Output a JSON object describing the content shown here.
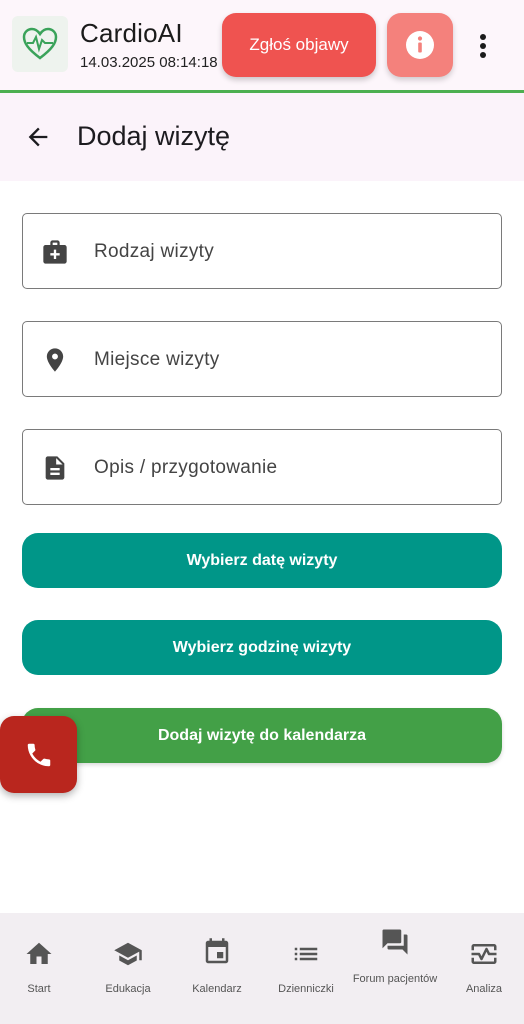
{
  "app": {
    "title": "CardioAI",
    "datetime": "14.03.2025 08:14:18",
    "logo_icon": "heart-ecg-icon",
    "report_button": "Zgłoś objawy",
    "info_icon": "info-icon",
    "menu_icon": "more-vert-icon"
  },
  "header": {
    "back_icon": "arrow-back-icon",
    "title": "Dodaj wizytę"
  },
  "form": {
    "visit_type": {
      "icon": "medical-bag-icon",
      "placeholder": "Rodzaj wizyty"
    },
    "visit_place": {
      "icon": "location-pin-icon",
      "placeholder": "Miejsce wizyty"
    },
    "visit_description": {
      "icon": "document-icon",
      "placeholder": "Opis / przygotowanie"
    },
    "choose_date": "Wybierz datę wizyty",
    "choose_time": "Wybierz godzinę wizyty",
    "add_to_calendar": "Dodaj wizytę do kalendarza"
  },
  "call_fab": {
    "icon": "phone-icon"
  },
  "bottom_nav": {
    "items": [
      {
        "label": "Start",
        "icon": "home-icon"
      },
      {
        "label": "Edukacja",
        "icon": "school-icon"
      },
      {
        "label": "Kalendarz",
        "icon": "calendar-icon"
      },
      {
        "label": "Dzienniczki",
        "icon": "list-icon"
      },
      {
        "label": "Forum pacjentów",
        "icon": "forum-icon"
      },
      {
        "label": "Analiza",
        "icon": "monitor-heart-icon"
      }
    ]
  },
  "colors": {
    "accent_green": "#4caf50",
    "report_red": "#ef5350",
    "teal": "#009688",
    "calendar_green": "#43a047",
    "call_red": "#b9261e"
  }
}
